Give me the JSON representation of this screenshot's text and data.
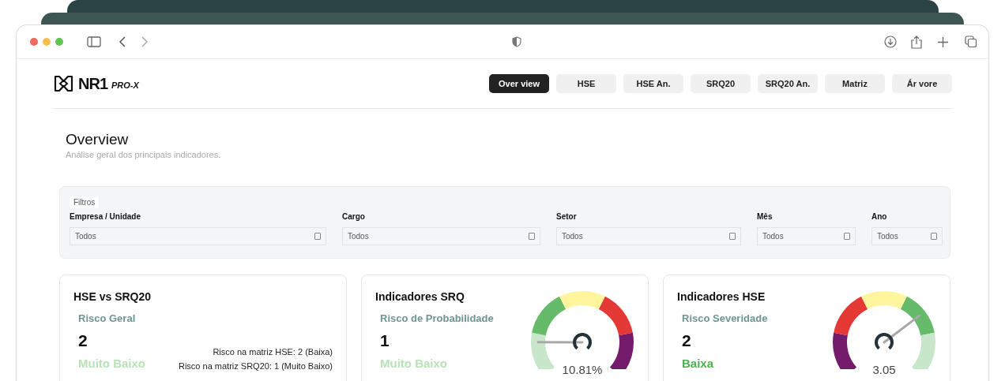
{
  "logo": {
    "name": "NR1",
    "suffix": "PRO-X"
  },
  "nav": [
    {
      "label": "Over view",
      "selected": true
    },
    {
      "label": "HSE",
      "selected": false
    },
    {
      "label": "HSE An.",
      "selected": false
    },
    {
      "label": "SRQ20",
      "selected": false
    },
    {
      "label": "SRQ20 An.",
      "selected": false
    },
    {
      "label": "Matriz",
      "selected": false
    },
    {
      "label": "Ár vore",
      "selected": false
    }
  ],
  "page": {
    "title": "Overview",
    "subtitle": "Análise geral dos principais indicadores."
  },
  "filters": {
    "title": "Filtros",
    "fields": [
      {
        "label": "Empresa / Unidade",
        "value": "Todos"
      },
      {
        "label": "Cargo",
        "value": "Todos"
      },
      {
        "label": "Setor",
        "value": "Todos"
      },
      {
        "label": "Mês",
        "value": "Todos"
      },
      {
        "label": "Ano",
        "value": "Todos"
      }
    ]
  },
  "cards": [
    {
      "kind": "summary",
      "title": "HSE vs SRQ20",
      "metric_label": "Risco Geral",
      "value": "2",
      "status": "Muito Baixo",
      "color": "#b8e2b8",
      "notes": [
        "Risco na matriz HSE: 2 (Baixa)",
        "Risco na matriz SRQ20: 1 (Muito Baixo)"
      ]
    },
    {
      "kind": "gauge",
      "title": "Indicadores SRQ",
      "metric_label": "Risco de Probabilidade",
      "value": "1",
      "status": "Muito Baixo",
      "color": "#b8e2b8",
      "reading": "10.81%",
      "level": 0.16,
      "segments": [
        {
          "color": "#c8e6c9"
        },
        {
          "color": "#66bb6a"
        },
        {
          "color": "#fff59d"
        },
        {
          "color": "#e53935"
        },
        {
          "color": "#741b6b"
        }
      ]
    },
    {
      "kind": "gauge",
      "title": "Indicadores HSE",
      "metric_label": "Risco Severidade",
      "value": "2",
      "status": "Baixa",
      "color": "#4caf50",
      "reading": "3.05",
      "level": 0.7,
      "segments": [
        {
          "color": "#741b6b"
        },
        {
          "color": "#e53935"
        },
        {
          "color": "#fff59d"
        },
        {
          "color": "#66bb6a"
        },
        {
          "color": "#c8e6c9"
        }
      ]
    }
  ]
}
